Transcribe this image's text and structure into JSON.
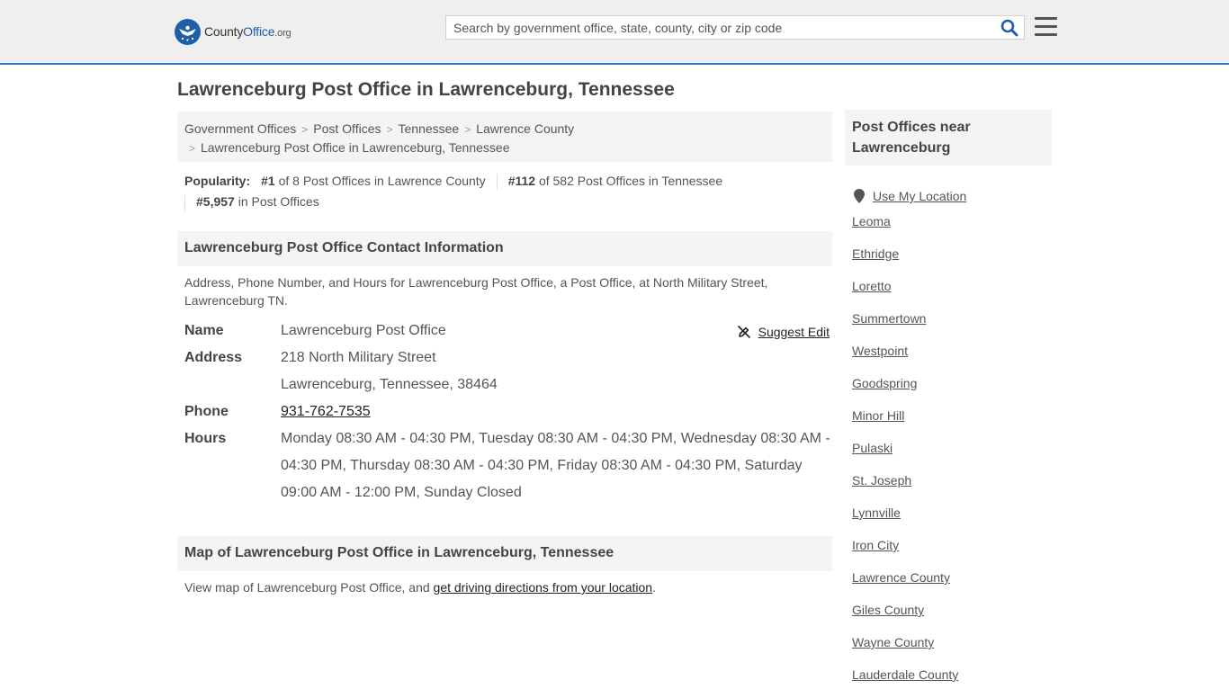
{
  "header": {
    "logo": {
      "brand": "County",
      "brand_accent": "Office",
      "tld": ".org"
    },
    "search": {
      "placeholder": "Search by government office, state, county, city or zip code",
      "value": ""
    },
    "icons": {
      "search": "search-icon",
      "menu": "hamburger-menu-icon"
    },
    "accent_color": "#3c7ac6"
  },
  "page_title": "Lawrenceburg Post Office in Lawrenceburg, Tennessee",
  "breadcrumb": {
    "items": [
      "Government Offices",
      "Post Offices",
      "Tennessee",
      "Lawrence County"
    ],
    "current": "Lawrenceburg Post Office in Lawrenceburg, Tennessee",
    "separator": ">"
  },
  "popularity": {
    "label": "Popularity:",
    "items": [
      {
        "rank": "#1",
        "text": "of 8 Post Offices in Lawrence County"
      },
      {
        "rank": "#112",
        "text": "of 582 Post Offices in Tennessee"
      },
      {
        "rank": "#5,957",
        "text": "in Post Offices"
      }
    ]
  },
  "contact": {
    "heading": "Lawrenceburg Post Office Contact Information",
    "description": "Address, Phone Number, and Hours for Lawrenceburg Post Office, a Post Office, at North Military Street, Lawrenceburg TN.",
    "suggest_edit": "Suggest Edit",
    "fields": {
      "name_label": "Name",
      "name": "Lawrenceburg Post Office",
      "address_label": "Address",
      "address_line1": "218 North Military Street",
      "address_line2": "Lawrenceburg, Tennessee, 38464",
      "phone_label": "Phone",
      "phone": "931-762-7535",
      "hours_label": "Hours",
      "hours": "Monday 08:30 AM - 04:30 PM, Tuesday 08:30 AM - 04:30 PM, Wednesday 08:30 AM - 04:30 PM, Thursday 08:30 AM - 04:30 PM, Friday 08:30 AM - 04:30 PM, Saturday 09:00 AM - 12:00 PM, Sunday Closed"
    }
  },
  "map": {
    "heading": "Map of Lawrenceburg Post Office in Lawrenceburg, Tennessee",
    "text_before": "View map of Lawrenceburg Post Office, and ",
    "link": "get driving directions from your location",
    "text_after": "."
  },
  "sidebar": {
    "heading": "Post Offices near Lawrenceburg",
    "use_location": "Use My Location",
    "links": [
      "Leoma",
      "Ethridge",
      "Loretto",
      "Summertown",
      "Westpoint",
      "Goodspring",
      "Minor Hill",
      "Pulaski",
      "St. Joseph",
      "Lynnville",
      "Iron City",
      "Lawrence County",
      "Giles County",
      "Wayne County",
      "Lauderdale County"
    ]
  }
}
